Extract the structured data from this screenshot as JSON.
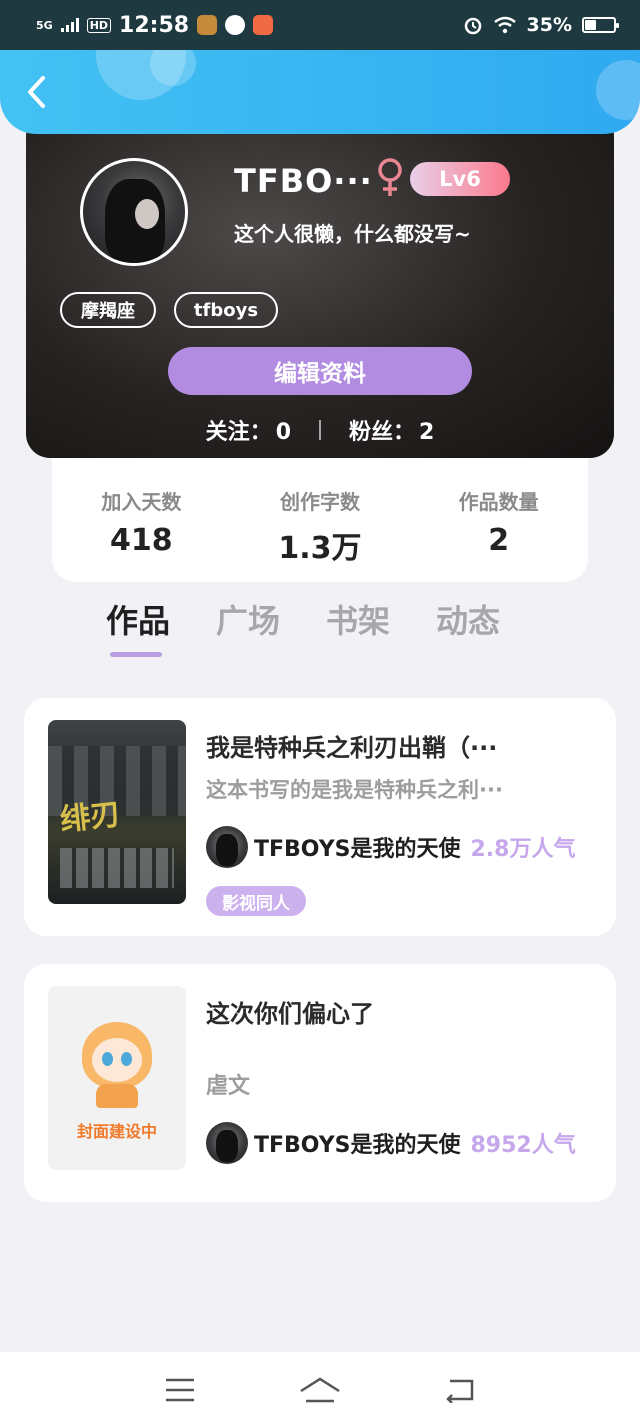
{
  "status_bar": {
    "network": "5G",
    "hd": "HD",
    "time": "12:58",
    "battery_percent": "35%",
    "battery_level": 0.35
  },
  "header": {
    "back_icon": "chevron-left-icon"
  },
  "profile": {
    "username": "TFBO···",
    "gender_symbol": "♀",
    "level": "Lv6",
    "bio": "这个人很懒，什么都没写~",
    "tags": [
      "摩羯座",
      "tfboys"
    ],
    "edit_button": "编辑资料",
    "following_label": "关注：",
    "following_count": "0",
    "followers_label": "粉丝：",
    "followers_count": "2"
  },
  "stats": [
    {
      "label": "加入天数",
      "value": "418"
    },
    {
      "label": "创作字数",
      "value": "1.3万"
    },
    {
      "label": "作品数量",
      "value": "2"
    }
  ],
  "tabs": [
    "作品",
    "广场",
    "书架",
    "动态"
  ],
  "active_tab": 0,
  "works": [
    {
      "title": "我是特种兵之利刃出鞘（···",
      "description": "这本书写的是我是特种兵之利···",
      "author": "TFBOYS是我的天使",
      "popularity": "2.8万人气",
      "genre_tag": "影视同人"
    },
    {
      "title": "这次你们偏心了",
      "genre": "虐文",
      "cover_caption": "封面建设中",
      "author": "TFBOYS是我的天使",
      "popularity": "8952人气"
    }
  ],
  "colors": {
    "accent_purple": "#b28ce0",
    "header_blue": "#43c2f3",
    "popularity_purple": "#c6a7ec"
  }
}
